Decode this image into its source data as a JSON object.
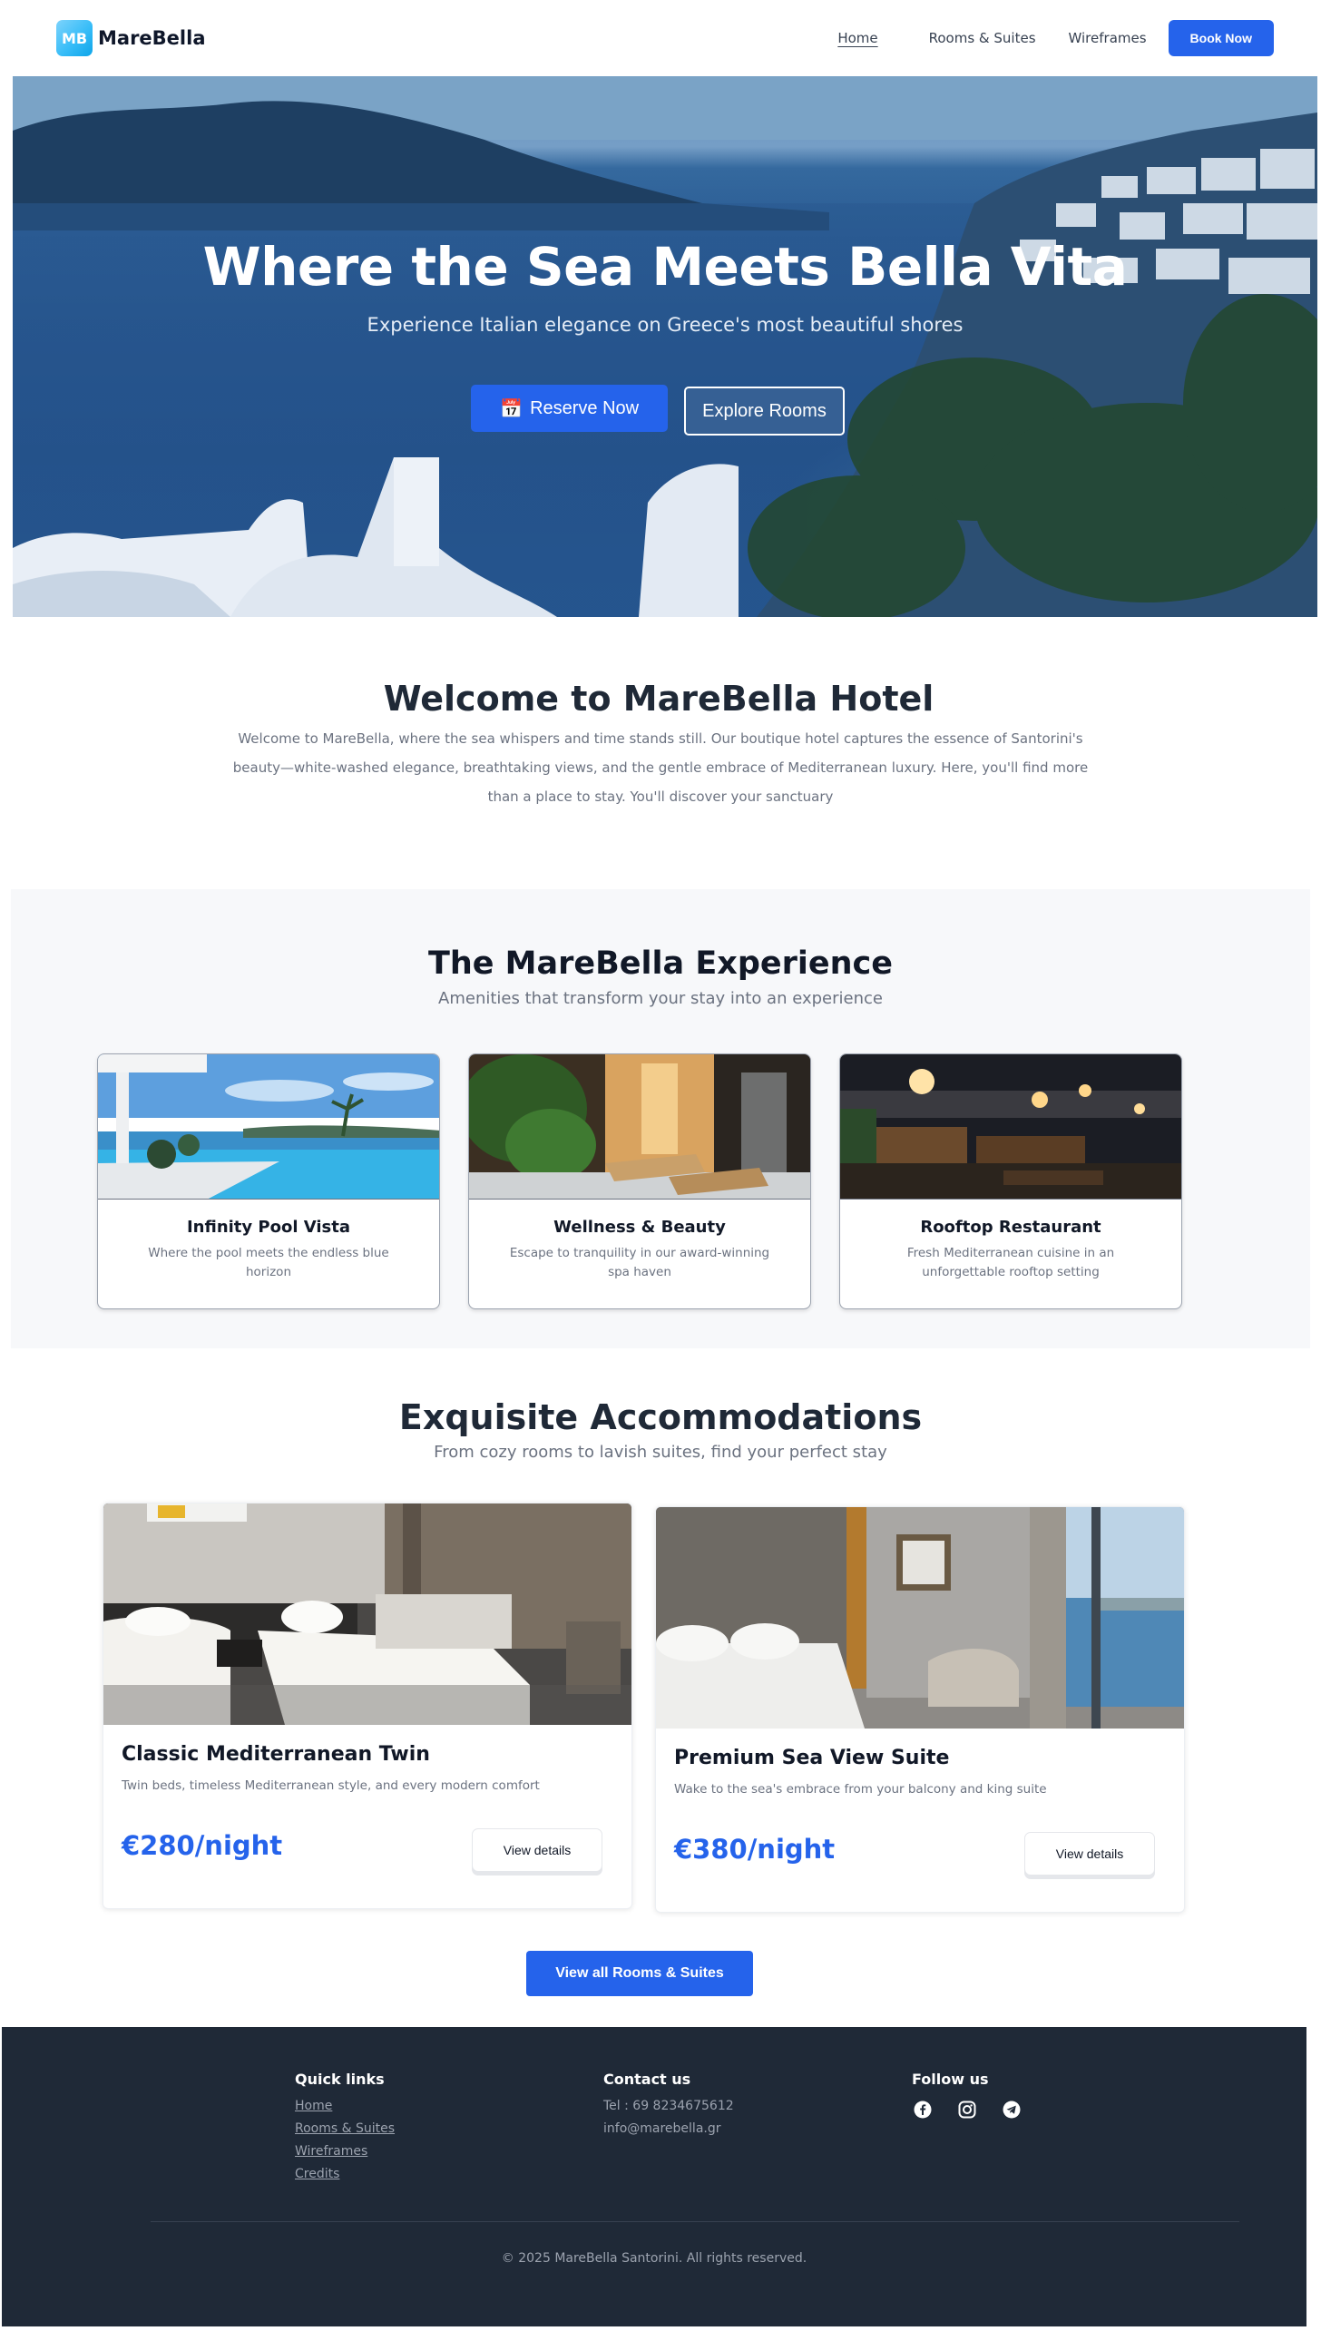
{
  "nav": {
    "logo_badge": "MB",
    "brand": "MareBella",
    "links": [
      "Home",
      "Rooms & Suites",
      "Wireframes"
    ],
    "cta": "Book Now"
  },
  "hero": {
    "title": "Where the Sea Meets Bella Vita",
    "subtitle": "Experience Italian elegance on Greece's most beautiful shores",
    "reserve_icon": "📅",
    "reserve_label": "Reserve Now",
    "explore_label": "Explore Rooms"
  },
  "welcome": {
    "title": "Welcome to MareBella Hotel",
    "text": "Welcome to MareBella, where the sea whispers and time stands still. Our boutique hotel captures the essence of Santorini's beauty—white-washed elegance, breathtaking views, and the gentle embrace of Mediterranean luxury. Here, you'll find more than a place to stay. You'll discover your sanctuary"
  },
  "experience": {
    "title": "The MareBella Experience",
    "subtitle": "Amenities that transform your stay into an experience",
    "cards": [
      {
        "title": "Infinity Pool Vista",
        "text": "Where the pool meets the endless blue horizon"
      },
      {
        "title": "Wellness & Beauty",
        "text": "Escape to tranquility in our award-winning spa haven"
      },
      {
        "title": "Rooftop Restaurant",
        "text": "Fresh Mediterranean cuisine in an unforgettable rooftop setting"
      }
    ]
  },
  "accommodations": {
    "title": "Exquisite Accommodations",
    "subtitle": "From cozy rooms to lavish suites, find your perfect stay",
    "rooms": [
      {
        "name": "Classic Mediterranean Twin",
        "desc": "Twin beds, timeless Mediterranean style, and every modern comfort",
        "price": "€280/night",
        "button": "View details"
      },
      {
        "name": "Premium Sea View Suite",
        "desc": "Wake to the sea's embrace from your balcony and king suite",
        "price": "€380/night",
        "button": "View details"
      }
    ],
    "view_all": "View all Rooms & Suites"
  },
  "footer": {
    "quick_links_title": "Quick links",
    "quick_links": [
      "Home",
      "Rooms & Suites",
      "Wireframes",
      "Credits"
    ],
    "contact_title": "Contact us",
    "phone": "Tel : 69 8234675612",
    "email": "info@marebella.gr",
    "follow_title": "Follow us",
    "socials": [
      "facebook-icon",
      "instagram-icon",
      "telegram-icon"
    ],
    "copyright": "© 2025 MareBella Santorini. All rights reserved."
  },
  "colors": {
    "primary": "#2563eb",
    "footer_bg": "#1f2937",
    "text_dark": "#1f2937",
    "text_muted": "#6b7280"
  }
}
